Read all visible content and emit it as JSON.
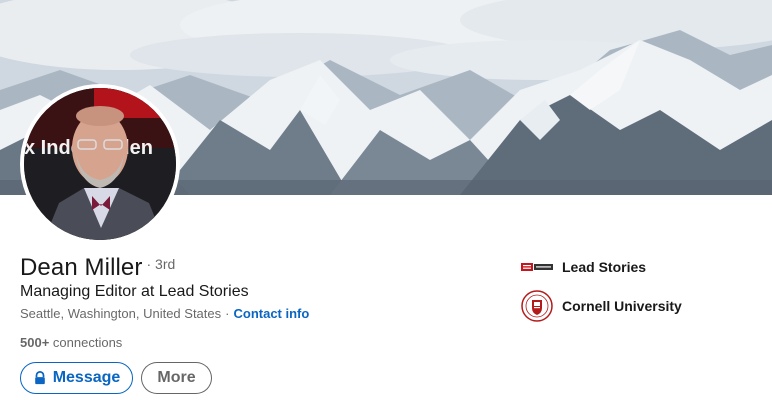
{
  "profile": {
    "name": "Dean Miller",
    "degree": "· 3rd",
    "headline": "Managing Editor at Lead Stories",
    "location": "Seattle, Washington, United States",
    "location_sep": "·",
    "contact_label": "Contact info",
    "connections_count": "500+",
    "connections_label": "connections"
  },
  "actions": {
    "message_label": "Message",
    "more_label": "More"
  },
  "sidebar": {
    "company": "Lead Stories",
    "school": "Cornell University"
  },
  "avatar_text": "x     Independen",
  "icons": {
    "lock": "lock-icon",
    "company_logo": "lead-stories-logo",
    "school_logo": "cornell-seal-logo"
  },
  "colors": {
    "accent": "#0a66c2",
    "seal_red": "#b31b1b"
  }
}
